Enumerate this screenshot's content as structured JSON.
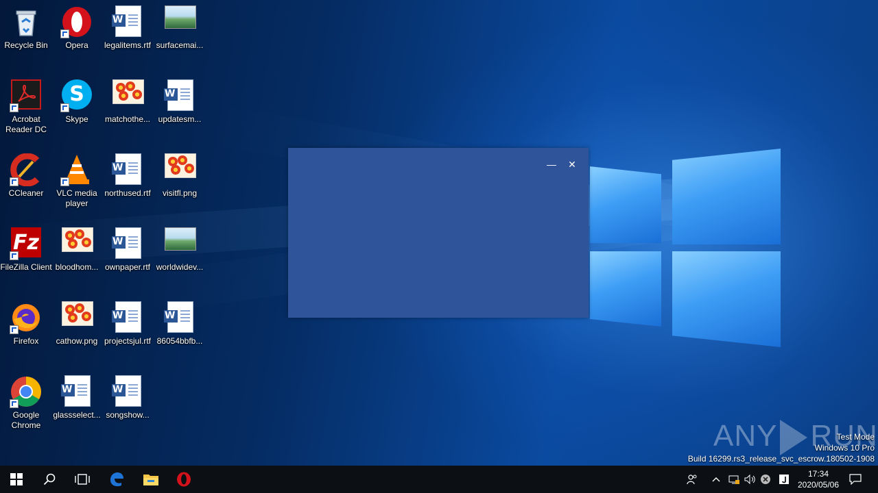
{
  "desktop": {
    "icons": [
      {
        "label": "Recycle Bin"
      },
      {
        "label": "Opera"
      },
      {
        "label": "legalitems.rtf"
      },
      {
        "label": "surfacemai..."
      },
      {
        "label": "Acrobat Reader DC"
      },
      {
        "label": "Skype"
      },
      {
        "label": "matchothe..."
      },
      {
        "label": "updatesm..."
      },
      {
        "label": "CCleaner"
      },
      {
        "label": "VLC media player"
      },
      {
        "label": "northused.rtf"
      },
      {
        "label": "visitfl.png"
      },
      {
        "label": "FileZilla Client"
      },
      {
        "label": "bloodhom..."
      },
      {
        "label": "ownpaper.rtf"
      },
      {
        "label": "worldwidev..."
      },
      {
        "label": "Firefox"
      },
      {
        "label": "cathow.png"
      },
      {
        "label": "projectsjul.rtf"
      },
      {
        "label": "86054bbfb..."
      },
      {
        "label": "Google Chrome"
      },
      {
        "label": "glassselect..."
      },
      {
        "label": "songshow..."
      }
    ]
  },
  "popup": {
    "minimize_glyph": "—",
    "close_glyph": "✕"
  },
  "watermark": {
    "left": "ANY",
    "right": "RUN"
  },
  "system_info": {
    "line1": "Test Mode",
    "line2": "Windows 10 Pro",
    "line3": "Build 16299.rs3_release_svc_escrow.180502-1908"
  },
  "taskbar": {
    "icons": [
      "windows-start-icon",
      "search-icon",
      "task-view-icon",
      "edge-icon",
      "file-explorer-icon",
      "opera-icon"
    ],
    "tray": [
      "people-icon",
      "chevron-up-icon",
      "network-icon",
      "volume-icon",
      "error-icon",
      "app-tray-icon",
      "action-center-icon"
    ],
    "time": "17:34",
    "date": "2020/05/06"
  },
  "colors": {
    "popup_bg": "#2f5499",
    "taskbar_bg": "#0c0f14",
    "edge_blue": "#1e74d6",
    "opera_red": "#d3121c"
  }
}
